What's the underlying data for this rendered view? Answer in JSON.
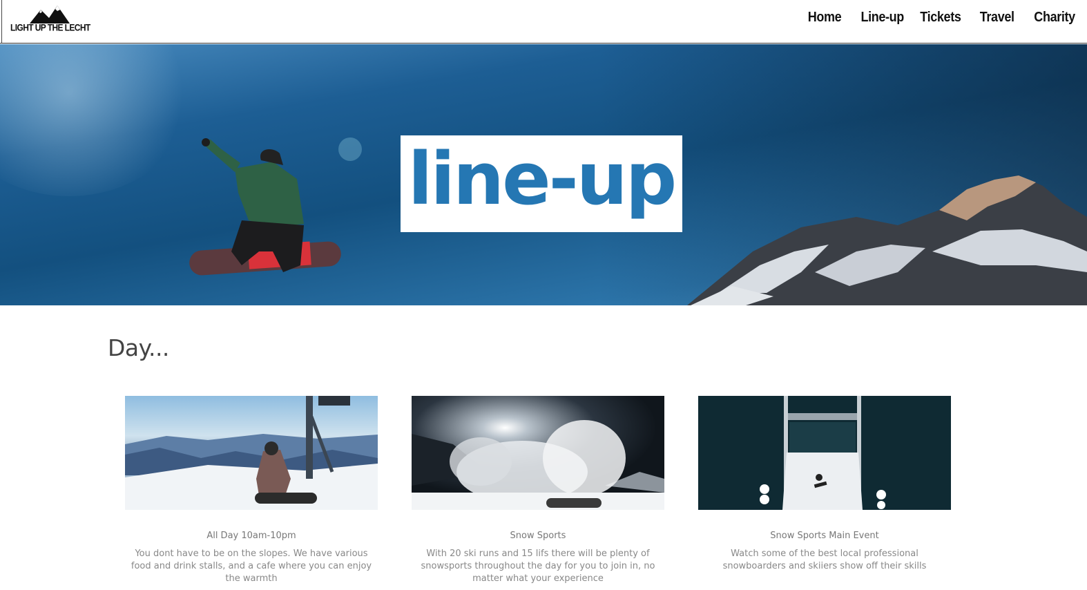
{
  "header": {
    "logo_text": "LIGHT UP THE LECHT",
    "nav": [
      "Home",
      "Line-up",
      "Tickets",
      "Travel",
      "Charity"
    ]
  },
  "hero": {
    "title": "line-up"
  },
  "section": {
    "heading": "Day..."
  },
  "cards": [
    {
      "title": "All Day 10am-10pm",
      "description": "You dont have to be on the slopes. We have various food and drink stalls, and a cafe where you can enjoy the warmth"
    },
    {
      "title": "Snow Sports",
      "description": "With 20 ski runs and 15 lifs there will be plenty of snowsports throughout the day for you to join in, no matter what your experience"
    },
    {
      "title": "Snow Sports Main Event",
      "description": "Watch some of the best local professional snowboarders and skiiers show off their skills"
    }
  ],
  "colors": {
    "title_blue": "#2577b3",
    "sky": "#1d5e94"
  }
}
